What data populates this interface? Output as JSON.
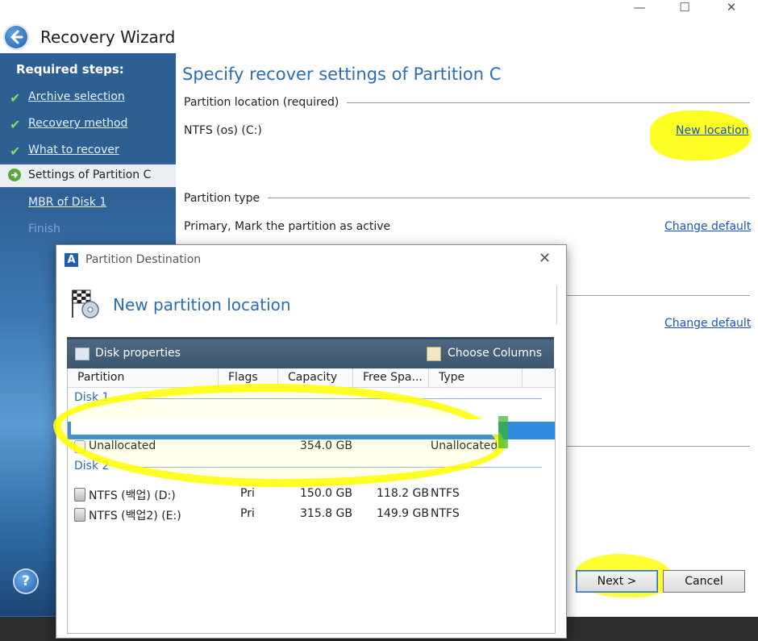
{
  "window": {
    "title": "Recovery Wizard",
    "minimize_glyph": "—",
    "maximize_glyph": "☐",
    "close_glyph": "✕"
  },
  "sidebar": {
    "heading": "Required steps:",
    "steps": [
      {
        "label": "Archive selection",
        "state": "done"
      },
      {
        "label": "Recovery method",
        "state": "done"
      },
      {
        "label": "What to recover",
        "state": "done"
      },
      {
        "label": "Settings of Partition C",
        "state": "current"
      },
      {
        "label": "MBR of Disk 1",
        "state": "pending"
      },
      {
        "label": "Finish",
        "state": "disabled"
      }
    ],
    "check_glyph": "✔"
  },
  "main": {
    "heading": "Specify recover settings of Partition C",
    "location_section": "Partition location (required)",
    "location_value": "NTFS (os) (C:)",
    "new_location_link": "New location",
    "type_section": "Partition type",
    "type_value": "Primary, Mark the partition as active",
    "change_default_link_1": "Change default",
    "change_default_link_2": "Change default"
  },
  "buttons": {
    "help": "?",
    "next": "Next >",
    "cancel": "Cancel"
  },
  "dialog": {
    "app_icon": "A",
    "title": "Partition Destination",
    "close_glyph": "✕",
    "heading": "New partition location",
    "toolbar": {
      "disk_properties": "Disk properties",
      "choose_columns": "Choose Columns"
    },
    "columns": [
      "Partition",
      "Flags",
      "Capacity",
      "Free Spa...",
      "Type"
    ],
    "groups": [
      {
        "name": "Disk 1",
        "rows": [
          {
            "partition": "Unallocated",
            "flags": "",
            "capacity": "354.0 GB",
            "free": "",
            "type": "Unallocated"
          }
        ]
      },
      {
        "name": "Disk 2",
        "rows": [
          {
            "partition": "NTFS (백업) (D:)",
            "flags": "Pri",
            "capacity": "150.0 GB",
            "free": "118.2 GB",
            "type": "NTFS"
          },
          {
            "partition": "NTFS (백업2) (E:)",
            "flags": "Pri",
            "capacity": "315.8 GB",
            "free": "149.9 GB",
            "type": "NTFS"
          }
        ]
      }
    ]
  },
  "colors": {
    "accent": "#2a6db5",
    "sidebar": "#2e5f93",
    "highlight": "#ffff00",
    "selection": "#2f8be0"
  }
}
